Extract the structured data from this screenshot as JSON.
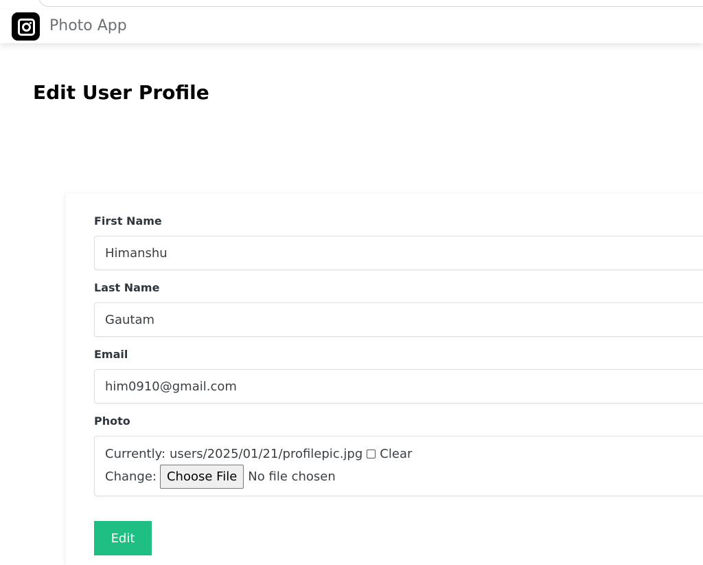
{
  "brand": {
    "name": "Photo App",
    "logo_icon": "camera-icon"
  },
  "page": {
    "title": "Edit User Profile"
  },
  "form": {
    "first_name": {
      "label": "First Name",
      "value": "Himanshu"
    },
    "last_name": {
      "label": "Last Name",
      "value": "Gautam"
    },
    "email": {
      "label": "Email",
      "value": "him0910@gmail.com"
    },
    "photo": {
      "label": "Photo",
      "currently_label": "Currently:",
      "current_file": "users/2025/01/21/profilepic.jpg",
      "clear_label": "Clear",
      "change_label": "Change:",
      "choose_button": "Choose File",
      "no_file_text": "No file chosen"
    },
    "submit_label": "Edit"
  },
  "colors": {
    "accent": "#1fbf83",
    "brand_text": "#6c7175"
  }
}
